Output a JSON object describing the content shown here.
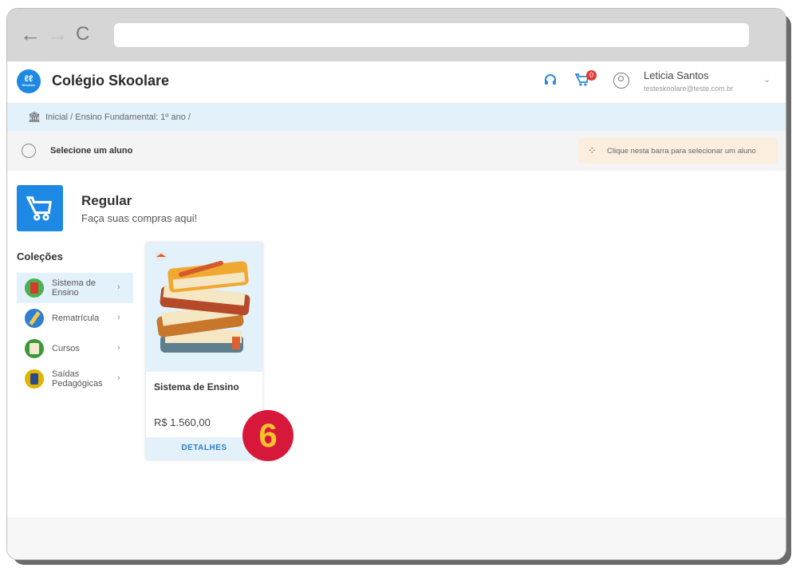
{
  "browser": {
    "back": "←",
    "forward": "→",
    "reload": "C"
  },
  "app": {
    "logo_text": "ℓℓ",
    "logo_sub": "Skoolare",
    "title": "Colégio Skoolare"
  },
  "header": {
    "cart_count": "0",
    "user_name": "Leticia Santos",
    "user_email": "testeskoolare@teste.com.br"
  },
  "breadcrumb": {
    "text": "Inicial  /  Ensino Fundamental: 1º ano  /"
  },
  "student_bar": {
    "label": "Selecione um aluno",
    "hint": "Clique nesta barra para selecionar um aluno"
  },
  "section": {
    "title": "Regular",
    "subtitle": "Faça suas compras aqui!"
  },
  "collections": {
    "title": "Coleções",
    "items": [
      {
        "label": "Sistema de Ensino",
        "color": "#d33b2b"
      },
      {
        "label": "Rematrícula",
        "color": "#2e7ed1"
      },
      {
        "label": "Cursos",
        "color": "#3a9a3a"
      },
      {
        "label": "Saídas Pedagógicas",
        "color": "#e0b400"
      }
    ]
  },
  "product": {
    "name": "Sistema de Ensino",
    "price": "R$ 1.560,00",
    "button": "DETALHES"
  },
  "step_badge": "6"
}
